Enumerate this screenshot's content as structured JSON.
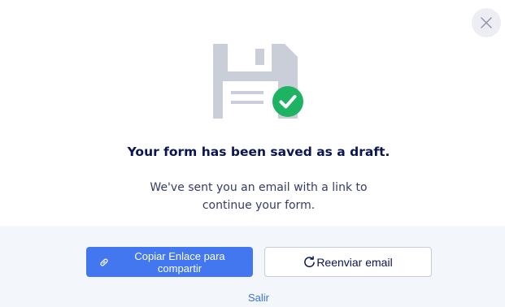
{
  "dialog": {
    "close_icon": "close-icon",
    "illustration_icons": [
      "floppy-disk-icon",
      "check-circle-icon"
    ],
    "colors": {
      "accent": "#4277f0",
      "success": "#1eb363",
      "title": "#0a1551",
      "text": "#343c6a",
      "illustration": "#c9ced9"
    },
    "title": "Your form has been saved as a draft.",
    "description_line1": "We've sent you an email with a link to",
    "description_line2": "continue your form."
  },
  "actions": {
    "copy_link": {
      "icon": "link-icon",
      "label_line1": "Copiar Enlace para",
      "label_line2": "compartir"
    },
    "resend": {
      "icon": "refresh-icon",
      "label": "Reenviar email"
    },
    "exit_label": "Salir"
  }
}
